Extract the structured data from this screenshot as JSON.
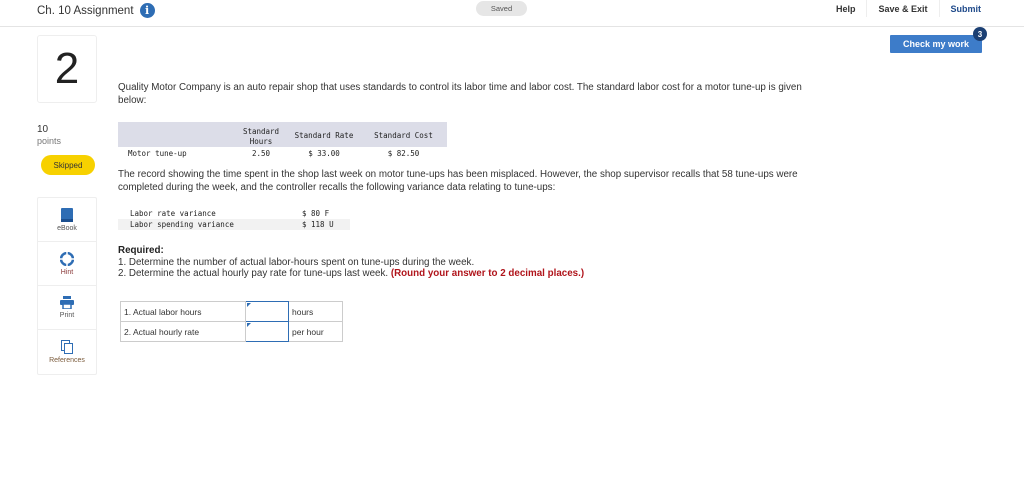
{
  "header": {
    "assignment_title": "Ch. 10 Assignment",
    "info_icon": "info-icon",
    "status": "Saved",
    "actions": [
      "Help",
      "Save & Exit",
      "Submit"
    ]
  },
  "check_work": {
    "label": "Check my work",
    "badge": "3"
  },
  "question": {
    "number": "2",
    "points_value": "10",
    "points_label": "points",
    "status_badge": "Skipped"
  },
  "tools": [
    {
      "label": "eBook",
      "icon": "book-icon"
    },
    {
      "label": "Hint",
      "icon": "lifebuoy-icon"
    },
    {
      "label": "Print",
      "icon": "printer-icon"
    },
    {
      "label": "References",
      "icon": "documents-icon"
    }
  ],
  "problem": {
    "intro": "Quality Motor Company is an auto repair shop that uses standards to control its labor time and labor cost. The standard labor cost for a motor tune-up is given below:",
    "standard_table": {
      "headers": [
        "",
        "Standard Hours",
        "Standard Rate",
        "Standard Cost"
      ],
      "header_lines": {
        "hours_line1": "Standard",
        "hours_line2": "Hours"
      },
      "rows": [
        [
          "Motor tune-up",
          "2.50",
          "$ 33.00",
          "$ 82.50"
        ]
      ]
    },
    "para2": "The record showing the time spent in the shop last week on motor tune-ups has been misplaced. However, the shop supervisor recalls that 58 tune-ups were completed during the week, and the controller recalls the following variance data relating to tune-ups:",
    "variance_table": [
      {
        "label": "Labor rate variance",
        "value": "$ 80 F"
      },
      {
        "label": "Labor spending variance",
        "value": "$ 118 U"
      }
    ],
    "required_title": "Required:",
    "required_items": [
      "1. Determine the number of actual labor-hours spent on tune-ups during the week.",
      "2. Determine the actual hourly pay rate for tune-ups last week."
    ],
    "required_note": "(Round your answer to 2 decimal places.)"
  },
  "answers": [
    {
      "label": "1. Actual labor hours",
      "value": "",
      "unit": "hours"
    },
    {
      "label": "2. Actual hourly rate",
      "value": "",
      "unit": "per hour"
    }
  ]
}
